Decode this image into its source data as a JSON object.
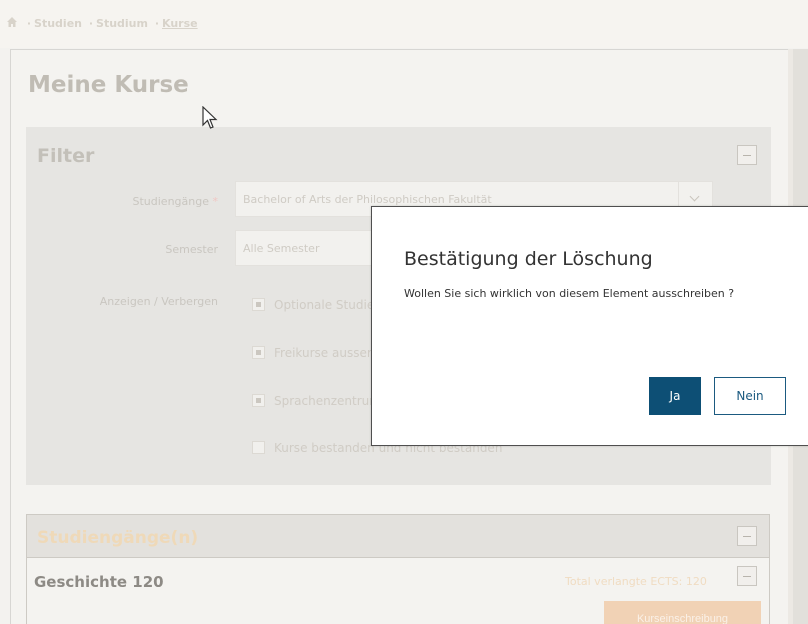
{
  "breadcrumb": {
    "home_icon": "home-icon",
    "items": [
      "Studien",
      "Studium",
      "Kurse"
    ]
  },
  "page": {
    "title": "Meine Kurse"
  },
  "filter": {
    "title": "Filter",
    "studiengaenge_label": "Studiengänge",
    "required_mark": "*",
    "studiengaenge_value": "Bachelor of Arts der Philosophischen Fakultät",
    "semester_label": "Semester",
    "semester_value": "Alle Semester",
    "toggle_label": "Anzeigen / Verbergen",
    "checkboxes": [
      {
        "label": "Optionale Studien",
        "checked": true
      },
      {
        "label": "Freikurse ausserhalb",
        "checked": true
      },
      {
        "label": "Sprachenzentrum",
        "checked": true
      },
      {
        "label": "Kurse bestanden und nicht bestanden",
        "checked": false
      }
    ]
  },
  "studiengaenge": {
    "title": "Studiengänge(n)",
    "program": "Geschichte 120",
    "ects": "Total verlangte ECTS: 120",
    "enrol_label": "Kurseinschreibung"
  },
  "dialog": {
    "title": "Bestätigung der Löschung",
    "message": "Wollen Sie sich wirklich von diesem Element ausschreiben ?",
    "yes_label": "Ja",
    "no_label": "Nein"
  },
  "colors": {
    "primary": "#0d4f75",
    "accent": "#f1d2b5"
  }
}
